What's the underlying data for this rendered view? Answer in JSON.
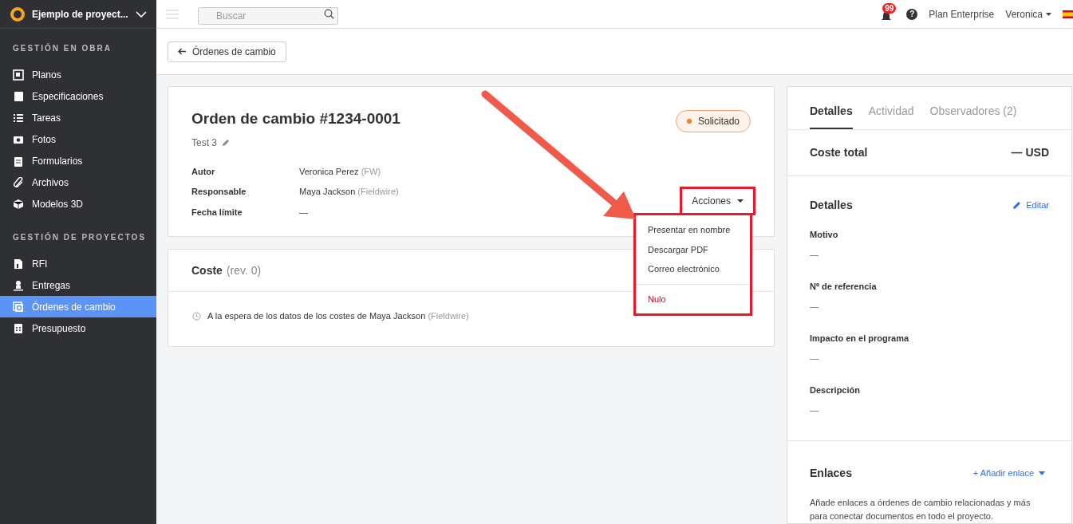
{
  "project": {
    "name": "Ejemplo de proyect..."
  },
  "search": {
    "placeholder": "Buscar"
  },
  "topbar": {
    "notifications": "99",
    "help": "?",
    "plan": "Plan Enterprise",
    "user": "Veronica"
  },
  "sidebar": {
    "sections": [
      {
        "title": "GESTIÓN EN OBRA",
        "items": [
          {
            "label": "Planos",
            "selected": false
          },
          {
            "label": "Especificaciones",
            "selected": false
          },
          {
            "label": "Tareas",
            "selected": false
          },
          {
            "label": "Fotos",
            "selected": false
          },
          {
            "label": "Formularios",
            "selected": false
          },
          {
            "label": "Archivos",
            "selected": false
          },
          {
            "label": "Modelos 3D",
            "selected": false
          }
        ]
      },
      {
        "title": "GESTIÓN DE PROYECTOS",
        "items": [
          {
            "label": "RFI",
            "selected": false
          },
          {
            "label": "Entregas",
            "selected": false
          },
          {
            "label": "Órdenes de cambio",
            "selected": true
          },
          {
            "label": "Presupuesto",
            "selected": false
          }
        ]
      }
    ]
  },
  "back_button": "Órdenes de cambio",
  "order": {
    "title": "Orden de cambio #1234-0001",
    "subtitle": "Test 3",
    "status": "Solicitado",
    "fields": [
      {
        "label": "Autor",
        "value": "Veronica Perez",
        "org": "(FW)"
      },
      {
        "label": "Responsable",
        "value": "Maya Jackson",
        "org": "(Fieldwire)"
      },
      {
        "label": "Fecha límite",
        "value": "—"
      }
    ],
    "actions": {
      "label": "Acciones",
      "highlighted": true,
      "menu": [
        {
          "label": "Presentar en nombre",
          "kind": "normal"
        },
        {
          "label": "Descargar PDF",
          "kind": "normal"
        },
        {
          "label": "Correo electrónico",
          "kind": "normal"
        },
        {
          "label": "Nulo",
          "kind": "danger"
        }
      ]
    }
  },
  "cost": {
    "title": "Coste",
    "revision": "(rev. 0)",
    "message": "A la espera de los datos de los costes de Maya Jackson",
    "org": "(Fieldwire)"
  },
  "panel": {
    "tabs": [
      {
        "label": "Detalles",
        "selected": true
      },
      {
        "label": "Actividad",
        "selected": false
      },
      {
        "label": "Observadores (2)",
        "selected": false
      }
    ],
    "total_label": "Coste total",
    "total_value": "— USD",
    "details_title": "Detalles",
    "edit": "Editar",
    "details": [
      {
        "label": "Motivo",
        "value": "—"
      },
      {
        "label": "Nº de referencia",
        "value": "—"
      },
      {
        "label": "Impacto en el programa",
        "value": "—"
      },
      {
        "label": "Descripción",
        "value": "—"
      }
    ],
    "links_title": "Enlaces",
    "add_link": "+ Añadir enlace",
    "links_text": "Añade enlaces a órdenes de cambio relacionadas y más para conectar documentos en todo el proyecto."
  }
}
